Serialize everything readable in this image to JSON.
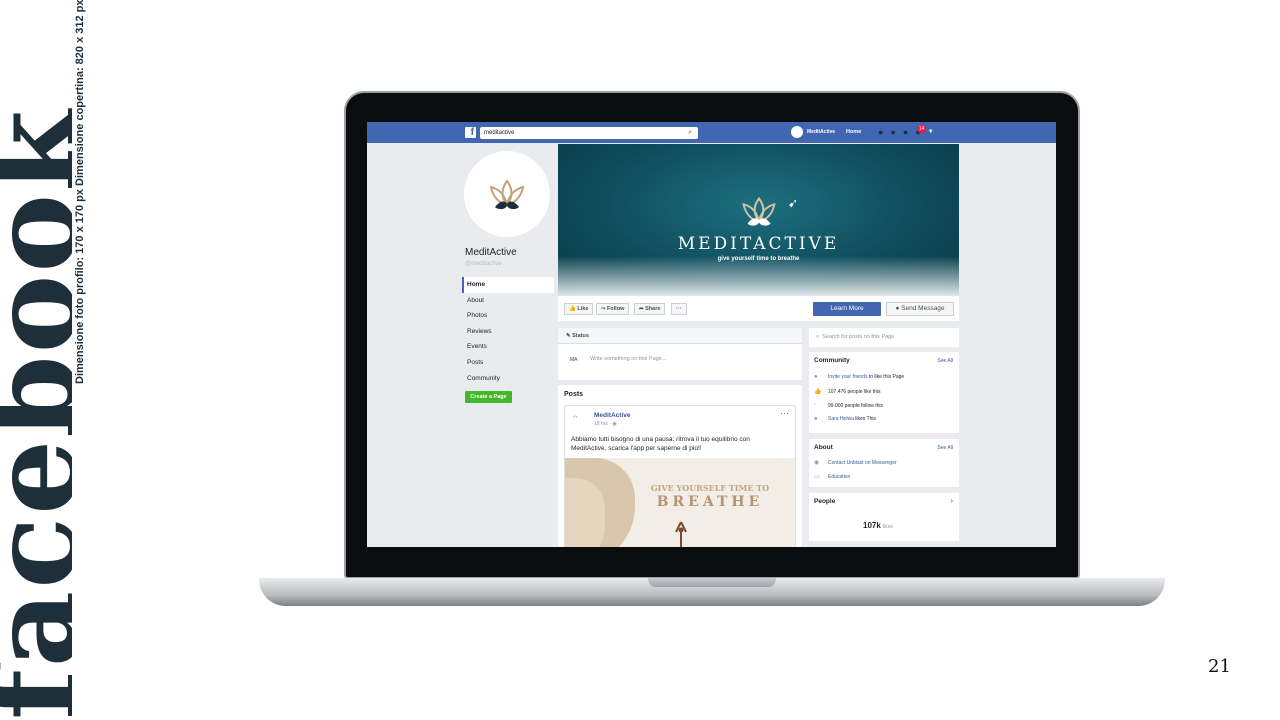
{
  "slide": {
    "vertical_title": "facebook",
    "dimensions_note": "Dimensione foto profilo: 170 x 170 px Dimensione copertina: 820 x 312 px",
    "page_number": "21"
  },
  "fb": {
    "search_value": "meditactive",
    "topbar_user": "MeditActive",
    "topbar_home": "Home",
    "notif_count": "14",
    "page_name": "MeditActive",
    "page_handle": "@meditactive",
    "nav_items": [
      "Home",
      "About",
      "Photos",
      "Reviews",
      "Events",
      "Posts",
      "Community"
    ],
    "create_page": "Create a Page",
    "cover_brand": "MEDITACTIVE",
    "cover_tagline": "give yourself time to breathe",
    "actions": {
      "like": "Like",
      "follow": "Follow",
      "share": "Share",
      "more": "···",
      "learn_more": "Learn More",
      "send_message": "Send Message"
    },
    "status": {
      "header": "Status",
      "placeholder": "Write something on this Page...",
      "avatar_text": "MA"
    },
    "posts_header": "Posts",
    "post": {
      "author": "MeditActive",
      "time": "18 hrs",
      "text": "Abbiamo tutti bisogno di una pausa: ritrova il tuo equilibrio con MeditActive, scarica l'app per saperne di più!!",
      "image_line1": "GIVE YOURSELF TIME TO",
      "image_line2": "BREATHE"
    },
    "right": {
      "search_placeholder": "Search for posts on this Page",
      "community_title": "Community",
      "see_all": "See All",
      "invite_link": "Invite your friends",
      "invite_rest": "to like this Page",
      "likes": "107.476 people like this",
      "follows": "99.000 people follow this",
      "friend_link": "Sara Helwa",
      "friend_rest": "likes This",
      "about_title": "About",
      "contact": "Contact Unblast on Messenger",
      "category": "Education",
      "people_title": "People",
      "people_count": "107k",
      "people_unit": "likes"
    },
    "accent": "#4267b2",
    "green": "#42b72a"
  }
}
